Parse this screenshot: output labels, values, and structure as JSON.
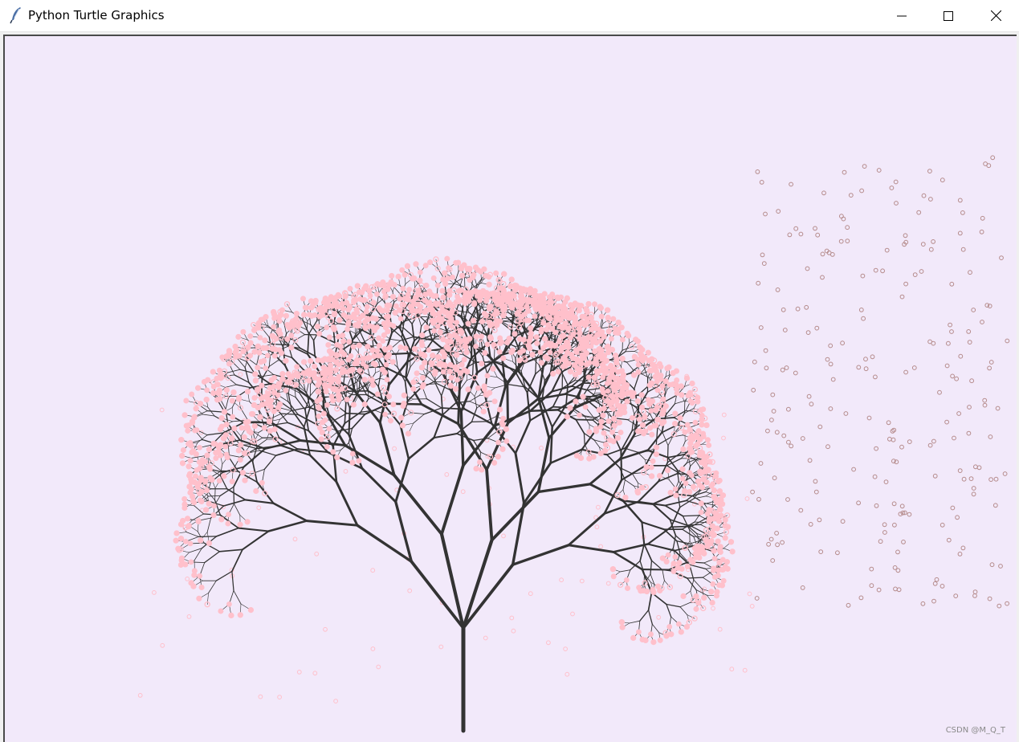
{
  "window": {
    "title": "Python Turtle Graphics",
    "icon": "feather-icon"
  },
  "controls": {
    "minimize_icon": "minimize-icon",
    "maximize_icon": "maximize-icon",
    "close_icon": "close-icon"
  },
  "canvas": {
    "background": "#f2e9fa",
    "branch_color": "#333333",
    "blossom_color": "#ffc0cb",
    "falling_petal_color": "#b58b8b",
    "watermark": "CSDN @M_Q_T"
  }
}
